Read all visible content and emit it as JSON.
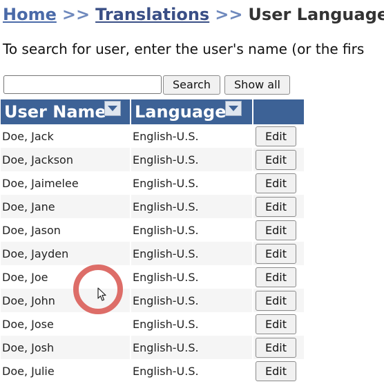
{
  "breadcrumb": {
    "home": "Home",
    "separator1": ">>",
    "translations": "Translations",
    "separator2": ">>",
    "current": "User Languages"
  },
  "instructions": "To search for user, enter the user's name (or the firs",
  "search": {
    "value": "",
    "placeholder": "",
    "search_label": "Search",
    "show_all_label": "Show all"
  },
  "table": {
    "headers": {
      "user_name": "User Name",
      "language": "Language",
      "actions": ""
    },
    "sort_icon": "chevron-down-icon",
    "edit_label": "Edit",
    "rows": [
      {
        "name": "Doe, Jack",
        "language": "English-U.S."
      },
      {
        "name": "Doe, Jackson",
        "language": "English-U.S."
      },
      {
        "name": "Doe, Jaimelee",
        "language": "English-U.S."
      },
      {
        "name": "Doe, Jane",
        "language": "English-U.S."
      },
      {
        "name": "Doe, Jason",
        "language": "English-U.S."
      },
      {
        "name": "Doe, Jayden",
        "language": "English-U.S."
      },
      {
        "name": "Doe, Joe",
        "language": "English-U.S."
      },
      {
        "name": "Doe, John",
        "language": "English-U.S."
      },
      {
        "name": "Doe, Jose",
        "language": "English-U.S."
      },
      {
        "name": "Doe, Josh",
        "language": "English-U.S."
      },
      {
        "name": "Doe, Julie",
        "language": "English-U.S."
      }
    ]
  },
  "colors": {
    "header_bg": "#3d6296",
    "link": "#4a6aa8",
    "click_indicator": "#dd6d68"
  }
}
